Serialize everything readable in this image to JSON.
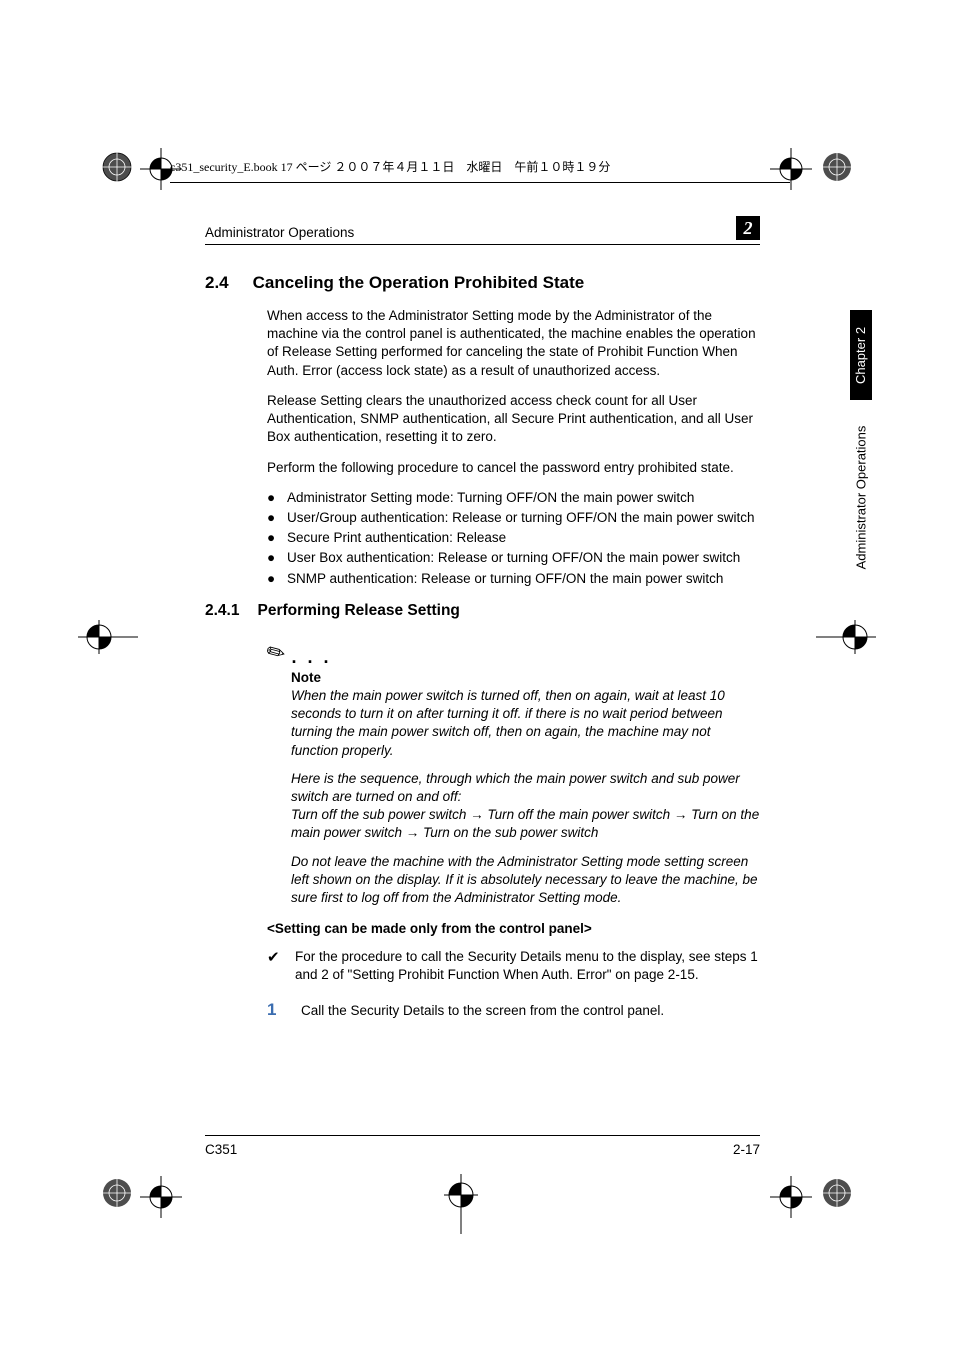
{
  "crop_info": "c351_security_E.book  17 ページ  ２００７年４月１１日　水曜日　午前１０時１９分",
  "header": {
    "title": "Administrator Operations",
    "chapter_number": "2"
  },
  "section": {
    "number": "2.4",
    "title": "Canceling the Operation Prohibited State"
  },
  "para1": "When access to the Administrator Setting mode by the Administrator of the machine via the control panel is authenticated, the machine enables the operation of Release Setting performed for canceling the state of Prohibit Function When Auth. Error (access lock state) as a result of unauthorized access.",
  "para2": "Release Setting clears the unauthorized access check count for all User Authentication, SNMP authentication, all Secure Print authentication, and all User Box authentication, resetting it to zero.",
  "para3": "Perform the following procedure to cancel the password entry prohibited state.",
  "bullets": [
    "Administrator Setting mode: Turning OFF/ON the main power switch",
    "User/Group authentication: Release or turning OFF/ON the main power switch",
    "Secure Print authentication: Release",
    "User Box authentication: Release or turning OFF/ON the main power switch",
    "SNMP authentication: Release or turning OFF/ON the main power switch"
  ],
  "subsection": {
    "number": "2.4.1",
    "title": "Performing Release Setting"
  },
  "note": {
    "label": "Note",
    "p1": "When the main power switch is turned off, then on again, wait at least 10 seconds to turn it on after turning it off. if there is no wait period between turning the main power switch off, then on again, the machine may not function properly.",
    "p2": "Here is the sequence, through which the main power switch and sub power switch are turned on and off:",
    "p3": "Turn off the sub power switch → Turn off the main power switch → Turn on the main power switch → Turn on the sub power switch",
    "p4": "Do not leave the machine with the Administrator Setting mode setting screen left shown on the display. If it is absolutely necessary to leave the machine, be sure first to log off from the Administrator Setting mode."
  },
  "panel_title": "<Setting can be made only from the control panel>",
  "check_item": "For the procedure to call the Security Details menu to the display, see steps 1 and 2 of \"Setting Prohibit Function When Auth. Error\" on page 2-15.",
  "step1": {
    "n": "1",
    "text": "Call the Security Details to the screen from the control panel."
  },
  "sidetab": {
    "chapter": "Chapter 2",
    "title": "Administrator Operations"
  },
  "footer": {
    "left": "C351",
    "right": "2-17"
  }
}
